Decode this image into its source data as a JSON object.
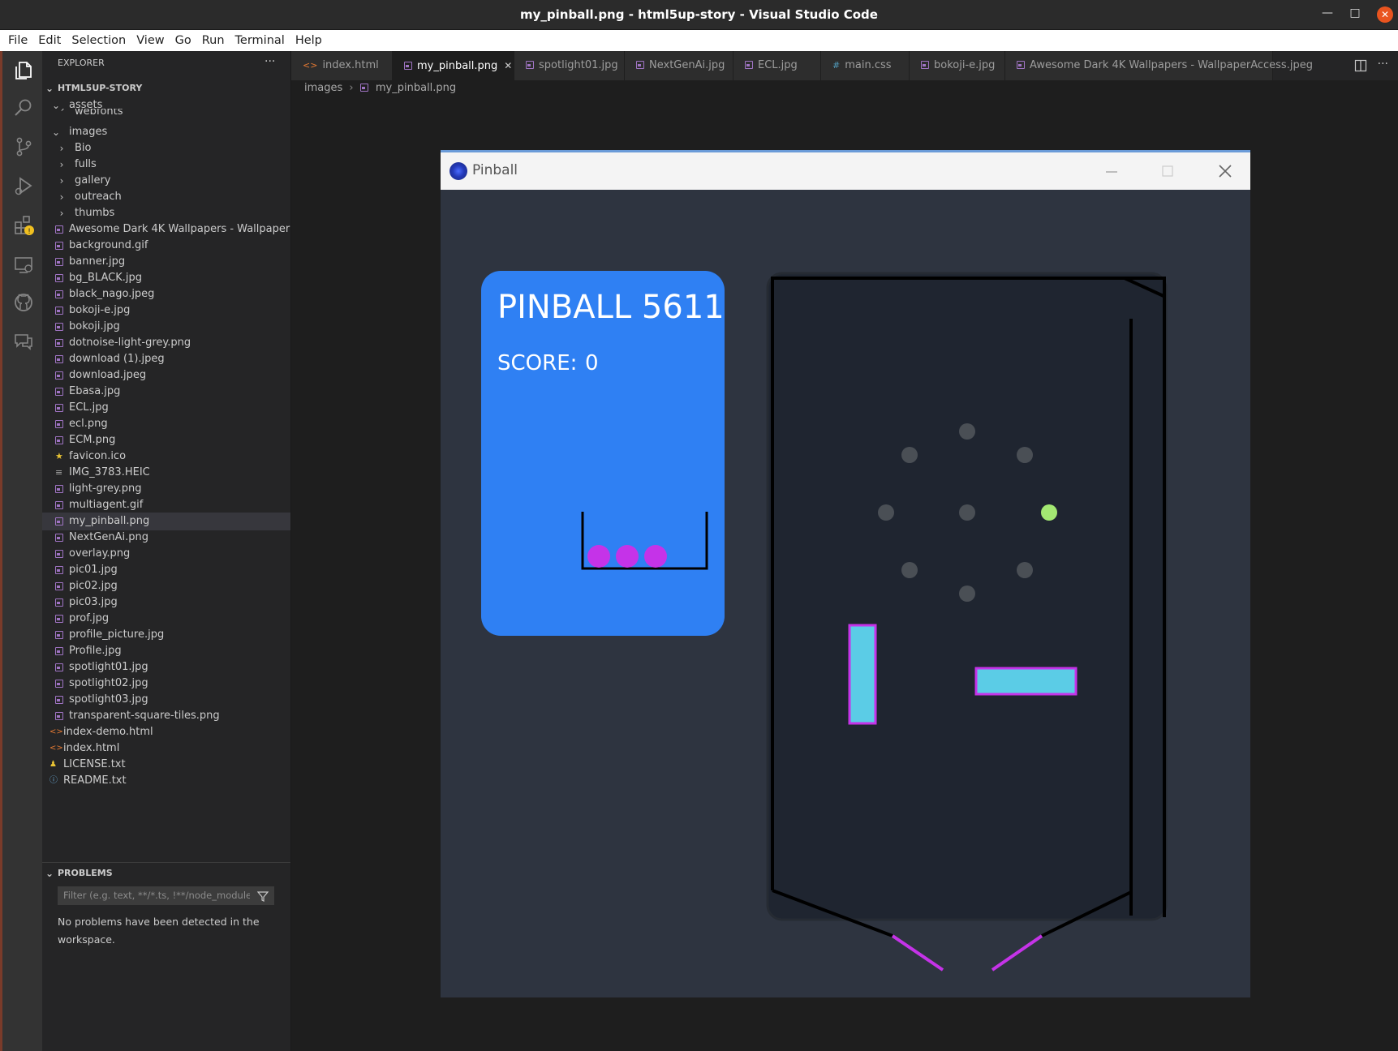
{
  "window": {
    "title": "my_pinball.png - html5up-story - Visual Studio Code",
    "controls": {
      "minimize": "—",
      "maximize": "□",
      "close": "✕"
    }
  },
  "menu": [
    "File",
    "Edit",
    "Selection",
    "View",
    "Go",
    "Run",
    "Terminal",
    "Help"
  ],
  "sidebar": {
    "header": "EXPLORER",
    "more": "···",
    "project": "HTML5UP-STORY",
    "folders": {
      "assets": "assets",
      "webfonts": "webfonts",
      "images": "images"
    },
    "subfolders": [
      "Bio",
      "fulls",
      "gallery",
      "outreach",
      "thumbs"
    ],
    "image_files": [
      "Awesome Dark 4K Wallpapers - Wallpaper…",
      "background.gif",
      "banner.jpg",
      "bg_BLACK.jpg",
      "black_nago.jpeg",
      "bokoji-e.jpg",
      "bokoji.jpg",
      "dotnoise-light-grey.png",
      "download (1).jpeg",
      "download.jpeg",
      "Ebasa.jpg",
      "ECL.jpg",
      "ecl.png",
      "ECM.png",
      "favicon.ico",
      "IMG_3783.HEIC",
      "light-grey.png",
      "multiagent.gif",
      "my_pinball.png",
      "NextGenAi.png",
      "overlay.png",
      "pic01.jpg",
      "pic02.jpg",
      "pic03.jpg",
      "prof.jpg",
      "profile_picture.jpg",
      "Profile.jpg",
      "spotlight01.jpg",
      "spotlight02.jpg",
      "spotlight03.jpg",
      "transparent-square-tiles.png"
    ],
    "selected_file": "my_pinball.png",
    "root_files": [
      "index-demo.html",
      "index.html",
      "LICENSE.txt",
      "README.txt"
    ],
    "problems": {
      "header": "PROBLEMS",
      "filter_placeholder": "Filter (e.g. text, **/*.ts, !**/node_module…",
      "message_line1": "No problems have been detected in the",
      "message_line2": "workspace."
    }
  },
  "tabs": [
    {
      "label": "index.html",
      "icon": "<>",
      "active": false
    },
    {
      "label": "my_pinball.png",
      "icon": "img",
      "active": true
    },
    {
      "label": "spotlight01.jpg",
      "icon": "img",
      "active": false
    },
    {
      "label": "NextGenAi.jpg",
      "icon": "img",
      "active": false
    },
    {
      "label": "ECL.jpg",
      "icon": "img",
      "active": false
    },
    {
      "label": "main.css",
      "icon": "#",
      "active": false
    },
    {
      "label": "bokoji-e.jpg",
      "icon": "img",
      "active": false
    },
    {
      "label": "Awesome Dark 4K Wallpapers - WallpaperAccess.jpeg",
      "icon": "img",
      "active": false
    }
  ],
  "breadcrumb": {
    "folder": "images",
    "file": "my_pinball.png"
  },
  "pinball": {
    "window_title": "Pinball",
    "heading": "PINBALL 5611",
    "score_label": "SCORE:",
    "score_value": "0",
    "balls_remaining": 3,
    "colors": {
      "background": "#2e3440",
      "panel": "#2f80f3",
      "table": "#1f2530",
      "bumper": "#4a4f55",
      "active_bumper": "#a3e872",
      "paddle_fill": "#5bcce6",
      "paddle_border": "#c533e8",
      "ball": "#c533e8"
    }
  }
}
